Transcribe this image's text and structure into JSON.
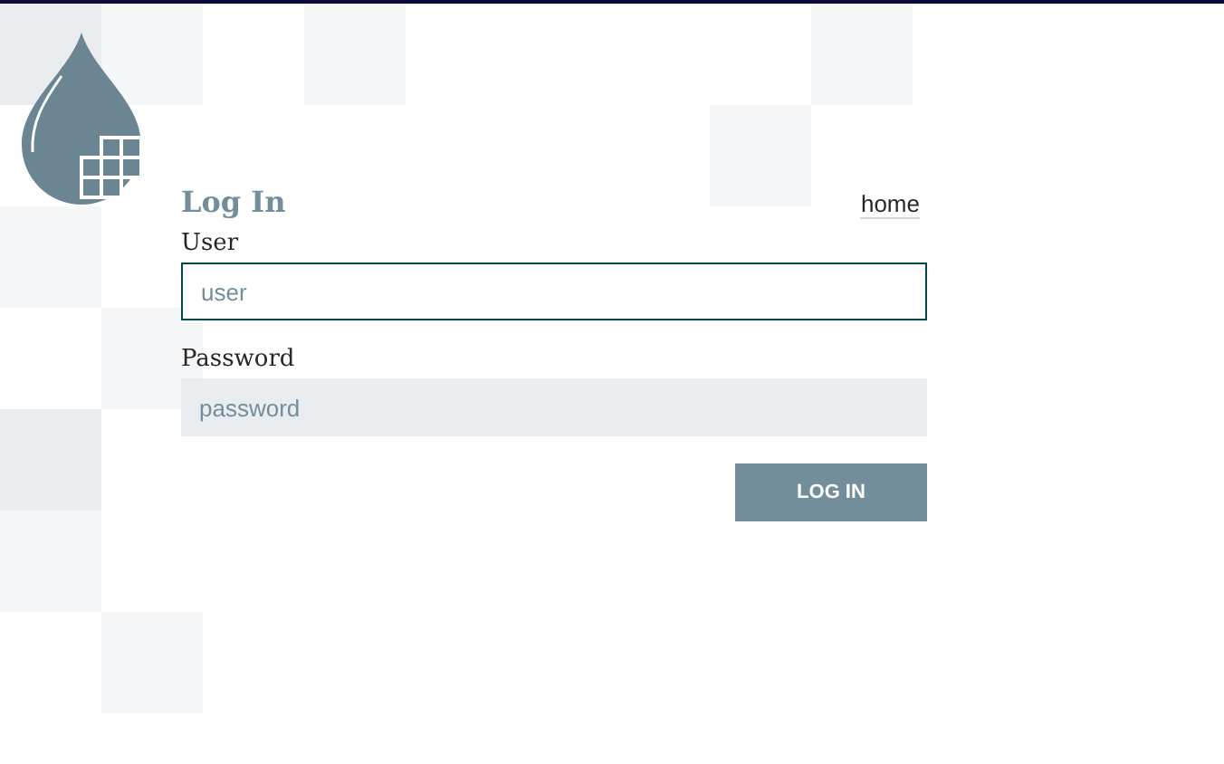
{
  "title": "Log In",
  "home_link": "home",
  "fields": [
    {
      "label": "User",
      "placeholder": "user",
      "focused": true
    },
    {
      "label": "Password",
      "placeholder": "password",
      "focused": false
    }
  ],
  "button": "LOG IN"
}
